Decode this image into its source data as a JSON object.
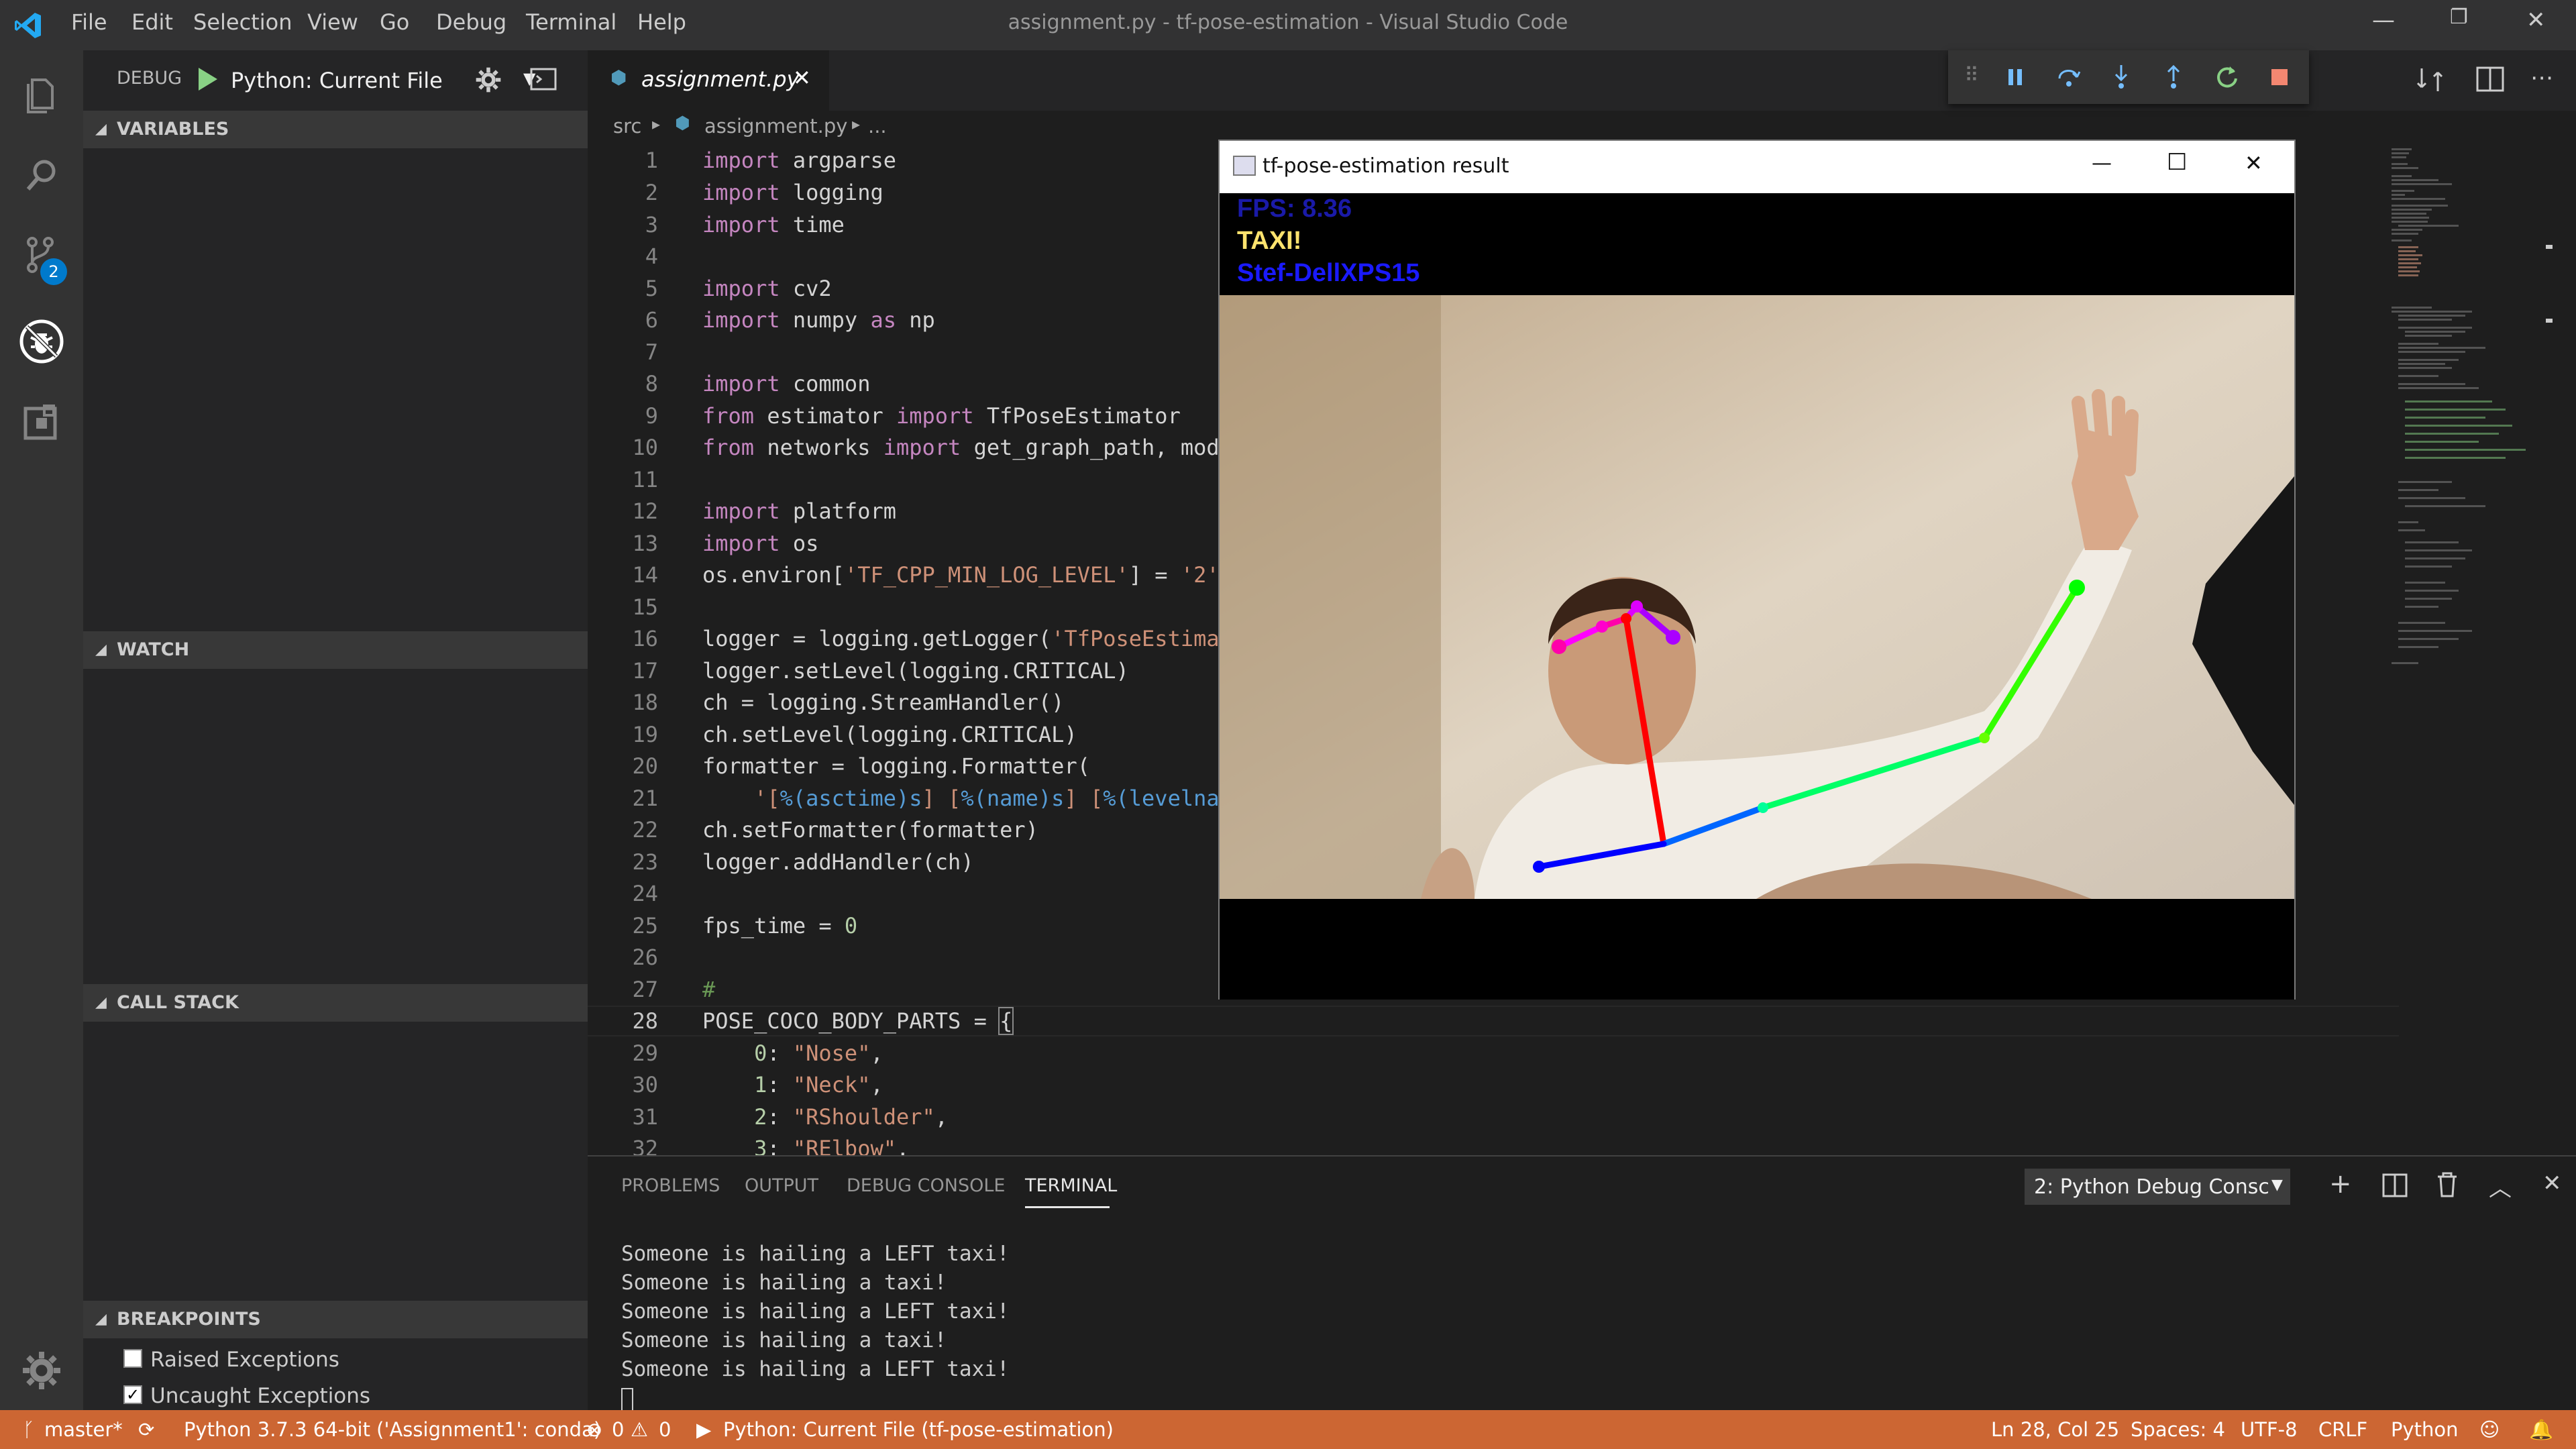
{
  "app": {
    "window_title": "assignment.py - tf-pose-estimation - Visual Studio Code",
    "menu": [
      "File",
      "Edit",
      "Selection",
      "View",
      "Go",
      "Debug",
      "Terminal",
      "Help"
    ]
  },
  "activity_bar": {
    "icons": [
      "files-icon",
      "search-icon",
      "source-control-icon",
      "debug-icon",
      "extensions-icon",
      "settings-gear-icon"
    ],
    "scm_badge": "2"
  },
  "debug": {
    "label": "DEBUG",
    "config": "Python: Current File"
  },
  "sidebar": {
    "sections": [
      "VARIABLES",
      "WATCH",
      "CALL STACK",
      "BREAKPOINTS"
    ],
    "breakpoints": [
      {
        "label": "Raised Exceptions",
        "checked": false
      },
      {
        "label": "Uncaught Exceptions",
        "checked": true
      }
    ]
  },
  "editor": {
    "tab": "assignment.py",
    "breadcrumb": [
      "src",
      "assignment.py",
      "..."
    ],
    "current_line": 28
  },
  "result_window": {
    "title": "tf-pose-estimation result",
    "fps": "FPS: 8.36",
    "status": "TAXI!",
    "host": "Stef-DellXPS15"
  },
  "panel": {
    "tabs": [
      "PROBLEMS",
      "OUTPUT",
      "DEBUG CONSOLE",
      "TERMINAL"
    ],
    "active_tab": "TERMINAL",
    "terminal_select": "2: Python Debug Consc",
    "terminal_lines": [
      "Someone is hailing a LEFT taxi!",
      "Someone is hailing a taxi!",
      "Someone is hailing a LEFT taxi!",
      "Someone is hailing a taxi!",
      "Someone is hailing a LEFT taxi!"
    ]
  },
  "statusbar": {
    "branch": "master*",
    "interpreter": "Python 3.7.3 64-bit ('Assignment1': conda)",
    "errors": "0",
    "warnings": "0",
    "debug_target": "Python: Current File (tf-pose-estimation)",
    "cursor": "Ln 28, Col 25",
    "spaces": "Spaces: 4",
    "encoding": "UTF-8",
    "eol": "CRLF",
    "language": "Python"
  },
  "colors": {
    "statusbar": "#cc6633",
    "editor_bg": "#1e1e1e",
    "sidebar_bg": "#252526",
    "accent": "#007acc"
  }
}
